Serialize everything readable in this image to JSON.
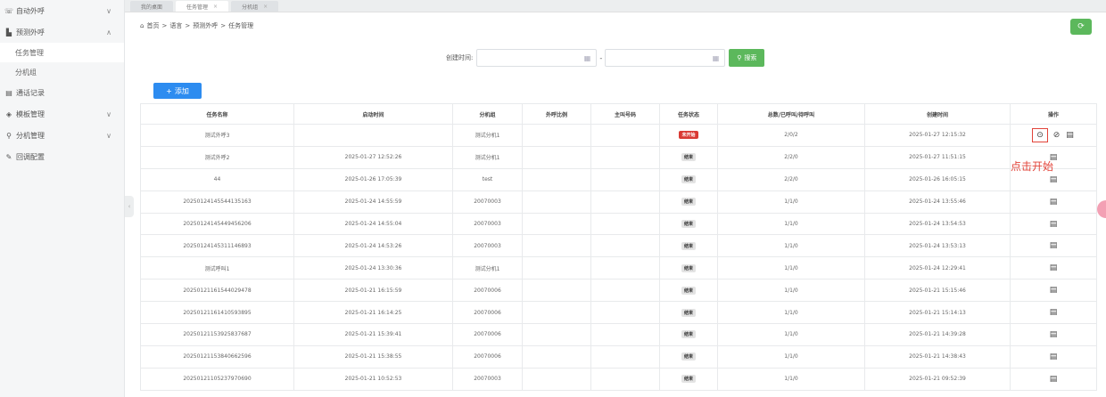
{
  "sidebar": {
    "items": [
      {
        "icon": "phone-icon",
        "glyph": "☏",
        "label": "自动外呼",
        "expand": "∨"
      },
      {
        "icon": "bar-chart-icon",
        "glyph": "▙",
        "label": "预测外呼",
        "expand": "∧"
      },
      {
        "icon": "document-icon",
        "glyph": "▤",
        "label": "通话记录",
        "expand": ""
      },
      {
        "icon": "template-icon",
        "glyph": "◈",
        "label": "模板管理",
        "expand": "∨"
      },
      {
        "icon": "search-icon",
        "glyph": "⚲",
        "label": "分机管理",
        "expand": "∨"
      },
      {
        "icon": "config-icon",
        "glyph": "✎",
        "label": "回调配置",
        "expand": ""
      }
    ],
    "subitems": [
      "任务管理",
      "分机组"
    ]
  },
  "tabs": [
    {
      "label": "我的桌面",
      "close": ""
    },
    {
      "label": "任务管理",
      "close": "×"
    },
    {
      "label": "分机组",
      "close": "×"
    }
  ],
  "breadcrumb": {
    "home_icon": "⌂",
    "items": [
      "首页",
      "语言",
      "预测外呼",
      "任务管理"
    ],
    "sep": ">"
  },
  "refresh_glyph": "⟳",
  "search": {
    "label": "创建时间:",
    "dash": "-",
    "button": "搜索",
    "button_icon": "⚲",
    "calendar_glyph": "▦"
  },
  "add_button": {
    "icon": "+",
    "label": "添加"
  },
  "table": {
    "headers": [
      "任务名称",
      "启动时间",
      "分机组",
      "外呼比例",
      "主叫号码",
      "任务状态",
      "总数/已呼叫/待呼叫",
      "创建时间",
      "操作"
    ],
    "rows": [
      {
        "name": "测试外呼3",
        "start": "",
        "group": "测试分机1",
        "ratio": "",
        "caller": "",
        "status": "未开始",
        "status_type": "notstarted",
        "counts": "2/0/2",
        "created": "2025-01-27 12:15:32",
        "ops": "full"
      },
      {
        "name": "测试外呼2",
        "start": "2025-01-27 12:52:26",
        "group": "测试分机1",
        "ratio": "",
        "caller": "",
        "status": "结束",
        "status_type": "done",
        "counts": "2/2/0",
        "created": "2025-01-27 11:51:15",
        "ops": "doc"
      },
      {
        "name": "44",
        "start": "2025-01-26 17:05:39",
        "group": "test",
        "ratio": "",
        "caller": "",
        "status": "结束",
        "status_type": "done",
        "counts": "2/2/0",
        "created": "2025-01-26 16:05:15",
        "ops": "doc"
      },
      {
        "name": "20250124145544135163",
        "start": "2025-01-24 14:55:59",
        "group": "20070003",
        "ratio": "",
        "caller": "",
        "status": "结束",
        "status_type": "done",
        "counts": "1/1/0",
        "created": "2025-01-24 13:55:46",
        "ops": "doc"
      },
      {
        "name": "20250124145449456206",
        "start": "2025-01-24 14:55:04",
        "group": "20070003",
        "ratio": "",
        "caller": "",
        "status": "结束",
        "status_type": "done",
        "counts": "1/1/0",
        "created": "2025-01-24 13:54:53",
        "ops": "doc"
      },
      {
        "name": "20250124145311146893",
        "start": "2025-01-24 14:53:26",
        "group": "20070003",
        "ratio": "",
        "caller": "",
        "status": "结束",
        "status_type": "done",
        "counts": "1/1/0",
        "created": "2025-01-24 13:53:13",
        "ops": "doc"
      },
      {
        "name": "测试呼叫1",
        "start": "2025-01-24 13:30:36",
        "group": "测试分机1",
        "ratio": "",
        "caller": "",
        "status": "结束",
        "status_type": "done",
        "counts": "1/1/0",
        "created": "2025-01-24 12:29:41",
        "ops": "doc"
      },
      {
        "name": "20250121161544029478",
        "start": "2025-01-21 16:15:59",
        "group": "20070006",
        "ratio": "",
        "caller": "",
        "status": "结束",
        "status_type": "done",
        "counts": "1/1/0",
        "created": "2025-01-21 15:15:46",
        "ops": "doc"
      },
      {
        "name": "20250121161410593895",
        "start": "2025-01-21 16:14:25",
        "group": "20070006",
        "ratio": "",
        "caller": "",
        "status": "结束",
        "status_type": "done",
        "counts": "1/1/0",
        "created": "2025-01-21 15:14:13",
        "ops": "doc"
      },
      {
        "name": "20250121153925837687",
        "start": "2025-01-21 15:39:41",
        "group": "20070006",
        "ratio": "",
        "caller": "",
        "status": "结束",
        "status_type": "done",
        "counts": "1/1/0",
        "created": "2025-01-21 14:39:28",
        "ops": "doc"
      },
      {
        "name": "20250121153840662596",
        "start": "2025-01-21 15:38:55",
        "group": "20070006",
        "ratio": "",
        "caller": "",
        "status": "结束",
        "status_type": "done",
        "counts": "1/1/0",
        "created": "2025-01-21 14:38:43",
        "ops": "doc"
      },
      {
        "name": "20250121105237970690",
        "start": "2025-01-21 10:52:53",
        "group": "20070003",
        "ratio": "",
        "caller": "",
        "status": "结束",
        "status_type": "done",
        "counts": "1/1/0",
        "created": "2025-01-21 09:52:39",
        "ops": "doc"
      }
    ]
  },
  "op_glyphs": {
    "play": "⊙",
    "stop": "⊘",
    "doc": "▤"
  },
  "annotation": "点击开始",
  "collapse_glyph": "‹",
  "colors": {
    "primary": "#2d8cf0",
    "success": "#5cb85c",
    "danger": "#d93a34",
    "annotation": "#e2443a"
  }
}
